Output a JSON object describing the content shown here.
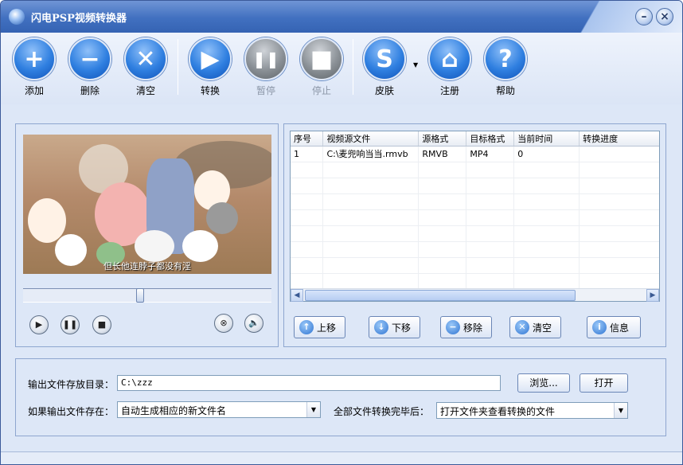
{
  "window": {
    "title": "闪电PSP视频转换器"
  },
  "toolbar": [
    {
      "label": "添加",
      "icon": "add-icon",
      "glyph": "+",
      "enabled": true
    },
    {
      "label": "删除",
      "icon": "remove-icon",
      "glyph": "−",
      "enabled": true
    },
    {
      "label": "清空",
      "icon": "clear-icon",
      "glyph": "✕",
      "enabled": true
    },
    {
      "label": "转换",
      "icon": "play-icon",
      "glyph": "▶",
      "enabled": true
    },
    {
      "label": "暂停",
      "icon": "pause-icon",
      "glyph": "❚❚",
      "enabled": false
    },
    {
      "label": "停止",
      "icon": "stop-icon",
      "glyph": "■",
      "enabled": false
    },
    {
      "label": "皮肤",
      "icon": "skin-icon",
      "glyph": "S",
      "enabled": true
    },
    {
      "label": "注册",
      "icon": "home-icon",
      "glyph": "⌂",
      "enabled": true
    },
    {
      "label": "帮助",
      "icon": "help-icon",
      "glyph": "?",
      "enabled": true
    }
  ],
  "player": {
    "subtitle": "但长他连脖子都没有淫",
    "seek_position": 0.47
  },
  "list": {
    "columns": [
      "序号",
      "视频源文件",
      "源格式",
      "目标格式",
      "当前时间",
      "转换进度"
    ],
    "rows": [
      [
        "1",
        "C:\\麦兜响当当.rmvb",
        "RMVB",
        "MP4",
        "0",
        ""
      ]
    ]
  },
  "list_buttons": [
    "上移",
    "下移",
    "移除",
    "清空",
    "信息"
  ],
  "output": {
    "dir_label": "输出文件存放目录：",
    "dir_value": "C:\\zzz",
    "browse": "浏览...",
    "open": "打开",
    "exists_label": "如果输出文件存在：",
    "exists_value": "自动生成相应的新文件名",
    "done_label": "全部文件转换完毕后：",
    "done_value": "打开文件夹查看转换的文件"
  },
  "colors": {
    "accent": "#2f7fe0",
    "title_bar": "#4170c0",
    "window_bg": "#dde7f7"
  }
}
